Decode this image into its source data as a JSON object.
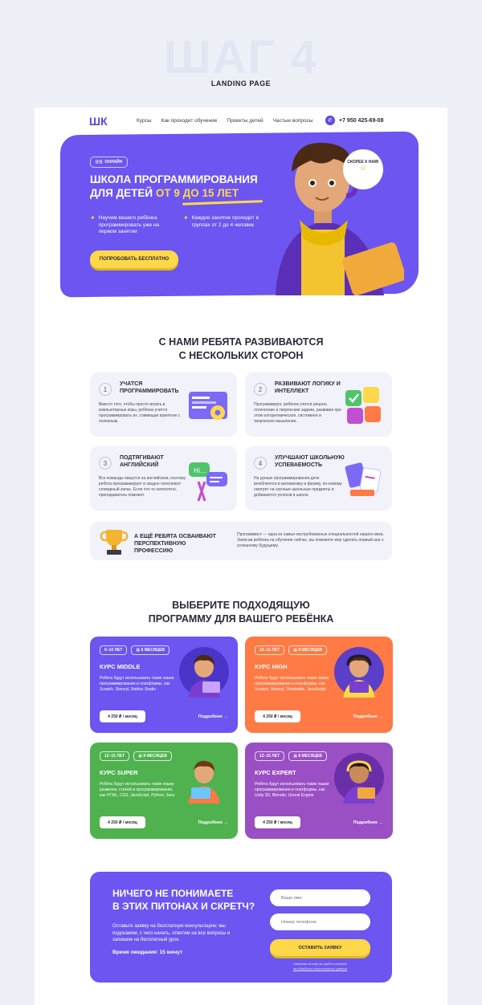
{
  "header": {
    "step_bg": "ШАГ 4",
    "label": "LANDING PAGE"
  },
  "nav": {
    "logo": "ШК",
    "links": [
      "Курсы",
      "Как проходит обучение",
      "Проекты детей",
      "Частые вопросы"
    ],
    "phone": "+7 950 425-69-08",
    "phone_icon": "phone-icon"
  },
  "hero": {
    "tag": "ОНЛАЙН",
    "title_1": "ШКОЛА ПРОГРАММИРОВАНИЯ",
    "title_2": "ДЛЯ ДЕТЕЙ",
    "title_3": "ОТ 9 ДО 15 ЛЕТ",
    "bullet_1": "Научим вашего ребёнка программировать уже на первом занятии",
    "bullet_2": "Каждое занятие проходит в группах от 2 до 4 человек",
    "cta": "ПОПРОБОВАТЬ БЕСПЛАТНО",
    "bubble": "СКОРЕЕ К НАМ!",
    "accent": "#6c55f0",
    "highlight": "#ffd84a"
  },
  "features": {
    "title_1": "С НАМИ РЕБЯТА РАЗВИВАЮТСЯ",
    "title_2": "С НЕСКОЛЬКИХ СТОРОН",
    "items": [
      {
        "num": "1",
        "title": "УЧАТСЯ ПРОГРАММИРОВАТЬ",
        "desc": "Вместо того, чтобы просто играть в компьютерные игры, ребёнок учится программировать их, совмещая приятное с полезным."
      },
      {
        "num": "2",
        "title": "РАЗВИВАЮТ ЛОГИКУ И ИНТЕЛЛЕКТ",
        "desc": "Программируя, ребёнок учится решать логические и творческие задачи, развивая при этом алгоритмическое, системное и творческое мышление."
      },
      {
        "num": "3",
        "title": "ПОДТЯГИВАЮТ АНГЛИЙСКИЙ",
        "desc": "Все команды пишутся на английском, поэтому ребята программируют и заодно пополняют словарный запас. Если что-то непонятно, преподаватель поможет."
      },
      {
        "num": "4",
        "title": "УЛУЧШАЮТ ШКОЛЬНУЮ УСПЕВАЕМОСТЬ",
        "desc": "На уроках программирования дети влюбляются в математику и физику, по-новому смотрят на скучные школьные предметы и добиваются успехов в школе."
      }
    ],
    "wide_title": "А ЕЩЁ РЕБЯТА ОСВАИВАЮТ ПЕРСПЕКТИВНУЮ ПРОФЕССИЮ",
    "wide_desc": "Программист — одна из самых востребованных специальностей нашего века. Записав ребёнка на обучение сейчас, вы поможете ему сделать первый шаг к успешному будущему."
  },
  "courses": {
    "title_1": "ВЫБЕРИТЕ ПОДХОДЯЩУЮ",
    "title_2": "ПРОГРАММУ ДЛЯ ВАШЕГО РЕБЁНКА",
    "items": [
      {
        "age": "9–10 ЛЕТ",
        "duration": "8 МЕСЯЦЕВ",
        "title": "КУРС MIDDLE",
        "desc": "Ребята будут использовать такие языки программирования и платформы, как Scratch, Stencyl, Roblox Studio",
        "price": "4 250 ₽ / месяц",
        "more": "Подробнее →",
        "color": "#6c55f0"
      },
      {
        "age": "10–12 ЛЕТ",
        "duration": "8 МЕСЯЦЕВ",
        "title": "КУРС HIGH",
        "desc": "Ребята будут использовать такие языки программирования и платформы, как Scratch, Stencyl, Thunkable, JavaScript",
        "price": "4 250 ₽ / месяц",
        "more": "Подробнее →",
        "color": "#ff7a45"
      },
      {
        "age": "12–15 ЛЕТ",
        "duration": "8 МЕСЯЦЕВ",
        "title": "КУРС SUPER",
        "desc": "Ребята будут использовать такие языки разметки, стилей и программирования, как HTML, CSS, JavaScript, Python, Java",
        "price": "4 250 ₽ / месяц",
        "more": "Подробнее →",
        "color": "#4fb24f"
      },
      {
        "age": "12–15 ЛЕТ",
        "duration": "8 МЕСЯЦЕВ",
        "title": "КУРС EXPERT",
        "desc": "Ребята будут использовать такие языки программирования и платформы, как Unity 3D, Blender, Unreal Engine",
        "price": "4 250 ₽ / месяц",
        "more": "Подробнее →",
        "color": "#9a4fc4"
      }
    ]
  },
  "form": {
    "title_1": "НИЧЕГО НЕ ПОНИМАЕТЕ",
    "title_2": "В ЭТИХ ПИТОНАХ И СКРЕТЧ?",
    "desc": "Оставьте заявку на бесплатную консультацию: мы подскажем, с чего начать, ответим на все вопросы и запишем на бесплатный урок.",
    "wait": "Время ожидания: 15 минут",
    "name_placeholder": "Ваше имя",
    "phone_placeholder": "Номер телефона",
    "submit": "ОСТАВИТЬ ЗАЯВКУ",
    "consent_1": "Нажимая кнопку, вы даёте согласие",
    "consent_2": "на обработку персональных данных"
  }
}
